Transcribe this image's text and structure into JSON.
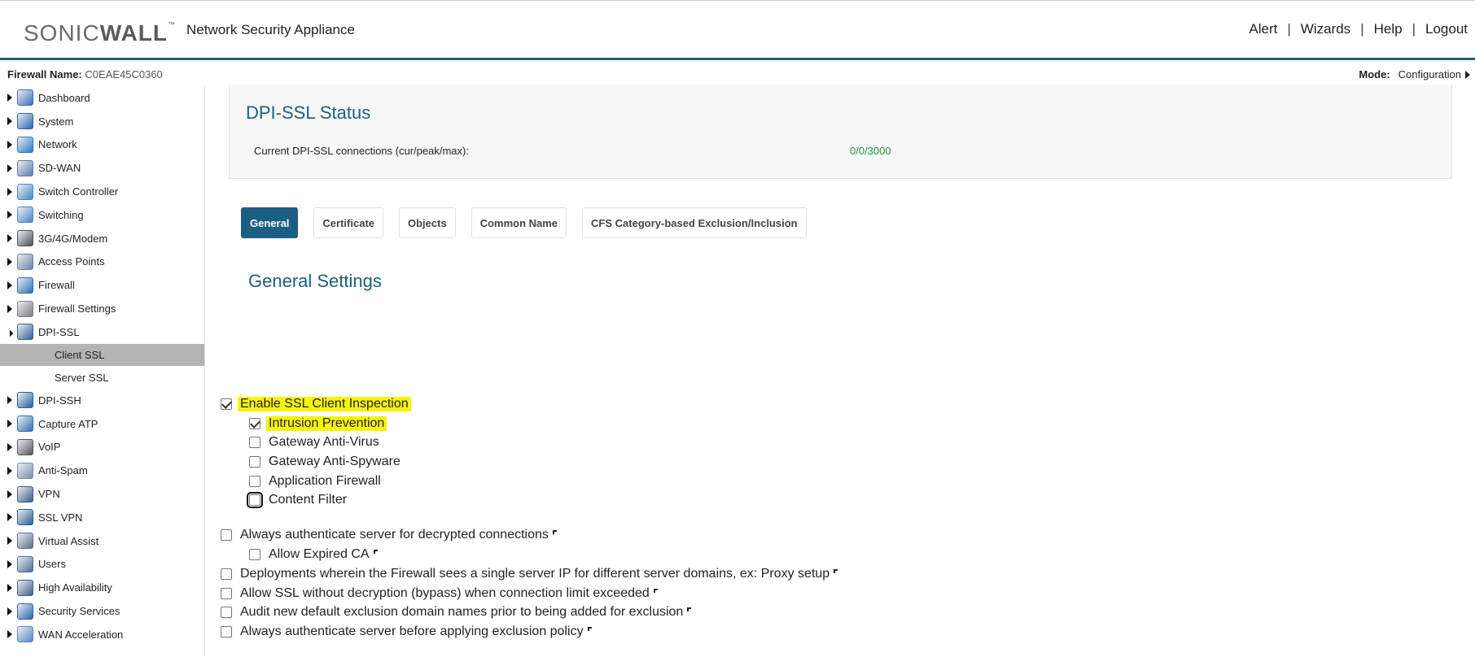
{
  "header": {
    "logo_text_light": "SONIC",
    "logo_text_bold": "WALL",
    "logo_tm": "™",
    "app_name": "Network Security Appliance",
    "links": [
      "Alert",
      "Wizards",
      "Help",
      "Logout"
    ],
    "separator": "|"
  },
  "subheader": {
    "firewall_label": "Firewall Name:",
    "firewall_value": "C0EAE45C0360",
    "mode_label": "Mode:",
    "mode_value": "Configuration"
  },
  "sidebar": {
    "items": [
      {
        "label": "Dashboard",
        "icon": "dashboard-icon",
        "color": "#3d6fb8"
      },
      {
        "label": "System",
        "icon": "monitor-icon",
        "color": "#2a64b0"
      },
      {
        "label": "Network",
        "icon": "globe-icon",
        "color": "#2d76c6"
      },
      {
        "label": "SD-WAN",
        "icon": "cloud-icon",
        "color": "#5c7aa8"
      },
      {
        "label": "Switch Controller",
        "icon": "switch-icon",
        "color": "#4a88c8"
      },
      {
        "label": "Switching",
        "icon": "switching-icon",
        "color": "#4a88c8"
      },
      {
        "label": "3G/4G/Modem",
        "icon": "modem-icon",
        "color": "#4b4f59"
      },
      {
        "label": "Access Points",
        "icon": "access-point-icon",
        "color": "#6b7fa3"
      },
      {
        "label": "Firewall",
        "icon": "firewall-icon",
        "color": "#2e6db4"
      },
      {
        "label": "Firewall Settings",
        "icon": "gear-icon",
        "color": "#7c7c7c"
      },
      {
        "label": "DPI-SSL",
        "icon": "lock-icon",
        "color": "#2f5f99",
        "open": true
      }
    ],
    "sub_items": [
      {
        "label": "Client SSL",
        "active": true
      },
      {
        "label": "Server SSL",
        "active": false
      }
    ],
    "items_after": [
      {
        "label": "DPI-SSH",
        "icon": "terminal-icon",
        "color": "#2a5f9c"
      },
      {
        "label": "Capture ATP",
        "icon": "capture-icon",
        "color": "#2f6fb0"
      },
      {
        "label": "VoIP",
        "icon": "headset-icon",
        "color": "#555555"
      },
      {
        "label": "Anti-Spam",
        "icon": "mail-icon",
        "color": "#7b8ea8"
      },
      {
        "label": "VPN",
        "icon": "vpn-lock-icon",
        "color": "#3d5c85"
      },
      {
        "label": "SSL VPN",
        "icon": "ssl-vpn-icon",
        "color": "#2b5d96"
      },
      {
        "label": "Virtual Assist",
        "icon": "assist-icon",
        "color": "#5b6f8c"
      },
      {
        "label": "Users",
        "icon": "users-icon",
        "color": "#4d6b96"
      },
      {
        "label": "High Availability",
        "icon": "server-icon",
        "color": "#3f5f8a"
      },
      {
        "label": "Security Services",
        "icon": "shield-icon",
        "color": "#2e63a8"
      },
      {
        "label": "WAN Acceleration",
        "icon": "document-icon",
        "color": "#5b86c2"
      }
    ]
  },
  "status": {
    "title": "DPI-SSL Status",
    "connections_label": "Current DPI-SSL connections (cur/peak/max):",
    "connections_value": "0/0/3000"
  },
  "tabs": [
    {
      "label": "General",
      "active": true
    },
    {
      "label": "Certificate",
      "active": false
    },
    {
      "label": "Objects",
      "active": false
    },
    {
      "label": "Common Name",
      "active": false
    },
    {
      "label": "CFS Category-based Exclusion/Inclusion",
      "active": false
    }
  ],
  "general": {
    "title": "General Settings",
    "options": [
      {
        "label": "Enable SSL Client Inspection",
        "checked": true,
        "highlight": true
      },
      {
        "label": "Intrusion Prevention",
        "checked": true,
        "highlight": true
      },
      {
        "label": "Gateway Anti-Virus",
        "checked": false
      },
      {
        "label": "Gateway Anti-Spyware",
        "checked": false
      },
      {
        "label": "Application Firewall",
        "checked": false
      },
      {
        "label": "Content Filter",
        "checked": false,
        "focused": true
      },
      {
        "label": "Always authenticate server for decrypted connections",
        "checked": false
      },
      {
        "label": "Allow Expired CA",
        "checked": false
      },
      {
        "label": "Deployments wherein the Firewall sees a single server IP for different server domains, ex: Proxy setup",
        "checked": false
      },
      {
        "label": "Allow SSL without decryption (bypass) when connection limit exceeded",
        "checked": false
      },
      {
        "label": "Audit new default exclusion domain names prior to being added for exclusion",
        "checked": false
      },
      {
        "label": "Always authenticate server before applying exclusion policy",
        "checked": false
      }
    ]
  },
  "colors": {
    "brand": "#1b5e82",
    "status_value": "#1e9a3a",
    "highlight": "#f7f30a",
    "active_sub": "#b4b4b4"
  }
}
